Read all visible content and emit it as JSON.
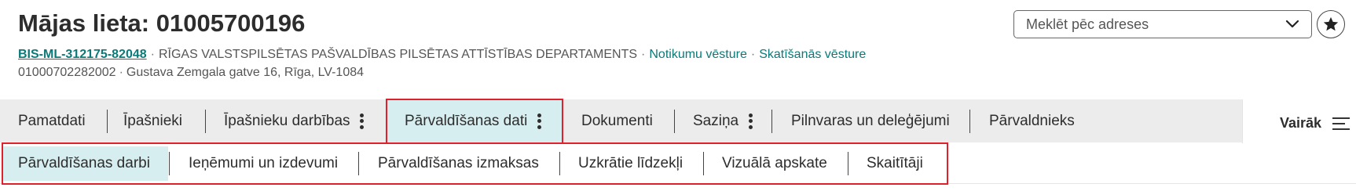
{
  "header": {
    "title": "Mājas lieta: 01005700196",
    "case_code": "BIS-ML-312175-82048",
    "organization": "RĪGAS VALSTSPILSĒTAS PAŠVALDĪBAS PILSĒTAS ATTĪSTĪBAS DEPARTAMENTS",
    "link_events": "Notikumu vēsture",
    "link_views": "Skatīšanās vēsture",
    "cadastre": "01000702282002",
    "address": "Gustava Zemgala gatve 16, Rīga, LV-1084",
    "separator": "·"
  },
  "search": {
    "placeholder": "Meklēt pēc adreses",
    "value": ""
  },
  "tabs": [
    {
      "label": "Pamatdati"
    },
    {
      "label": "Īpašnieki"
    },
    {
      "label": "Īpašnieku darbības"
    },
    {
      "label": "Pārvaldīšanas dati"
    },
    {
      "label": "Dokumenti"
    },
    {
      "label": "Saziņa"
    },
    {
      "label": "Pilnvaras un deleģējumi"
    },
    {
      "label": "Pārvaldnieks"
    }
  ],
  "more_label": "Vairāk",
  "subtabs": [
    {
      "label": "Pārvaldīšanas darbi"
    },
    {
      "label": "Ieņēmumi un izdevumi"
    },
    {
      "label": "Pārvaldīšanas izmaksas"
    },
    {
      "label": "Uzkrātie līdzekļi"
    },
    {
      "label": "Vizuālā apskate"
    },
    {
      "label": "Skaitītāji"
    }
  ],
  "colors": {
    "accent_link": "#0a7a78",
    "active_tab_bg": "#d7eef0",
    "highlight_box": "#e0212b",
    "tabbar_bg": "#ececec"
  },
  "icons": {
    "search_dropdown": "chevron-down-icon",
    "favorite": "star-icon",
    "tab_menu": "kebab-icon",
    "more_menu": "hamburger-icon"
  }
}
